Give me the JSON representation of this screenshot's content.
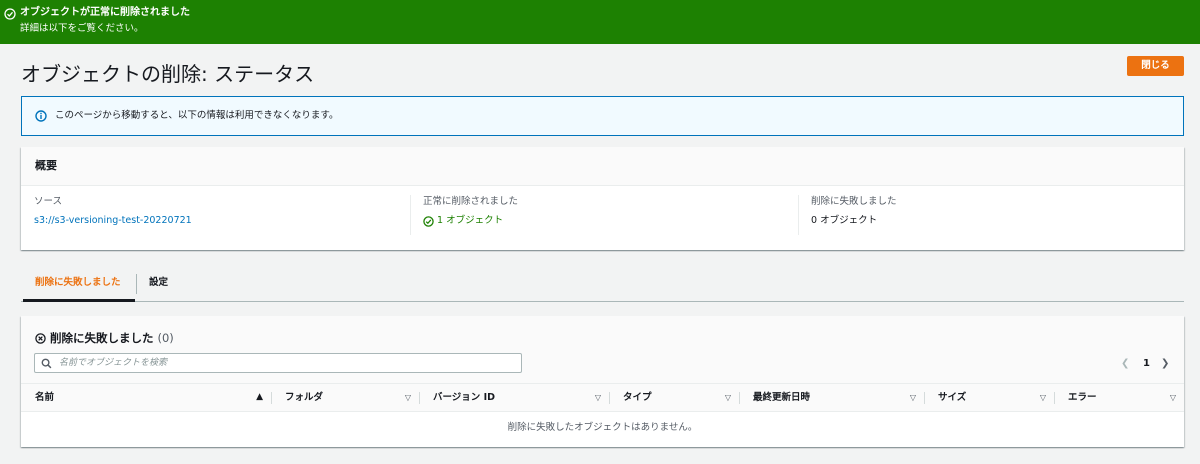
{
  "flash": {
    "title": "オブジェクトが正常に削除されました",
    "subtitle": "詳細は以下をご覧ください。"
  },
  "page": {
    "title": "オブジェクトの削除: ステータス",
    "close_label": "閉じる"
  },
  "info": {
    "text": "このページから移動すると、以下の情報は利用できなくなります。"
  },
  "summary": {
    "title": "概要",
    "source_label": "ソース",
    "source_value": "s3://s3-versioning-test-20220721",
    "success_label": "正常に削除されました",
    "success_value": "1 オブジェクト",
    "failed_label": "削除に失敗しました",
    "failed_value": "0 オブジェクト"
  },
  "tabs": [
    {
      "label": "削除に失敗しました",
      "active": true
    },
    {
      "label": "設定",
      "active": false
    }
  ],
  "failed_table": {
    "title": "削除に失敗しました",
    "count": "(0)",
    "search_placeholder": "名前でオブジェクトを検索",
    "page": "1",
    "columns": [
      "名前",
      "フォルダ",
      "バージョン ID",
      "タイプ",
      "最終更新日時",
      "サイズ",
      "エラー"
    ],
    "empty_message": "削除に失敗したオブジェクトはありません。"
  },
  "colors": {
    "success": "#1d8102",
    "accent": "#ec7211",
    "link": "#0073bb",
    "info_bg": "#f1faff"
  }
}
